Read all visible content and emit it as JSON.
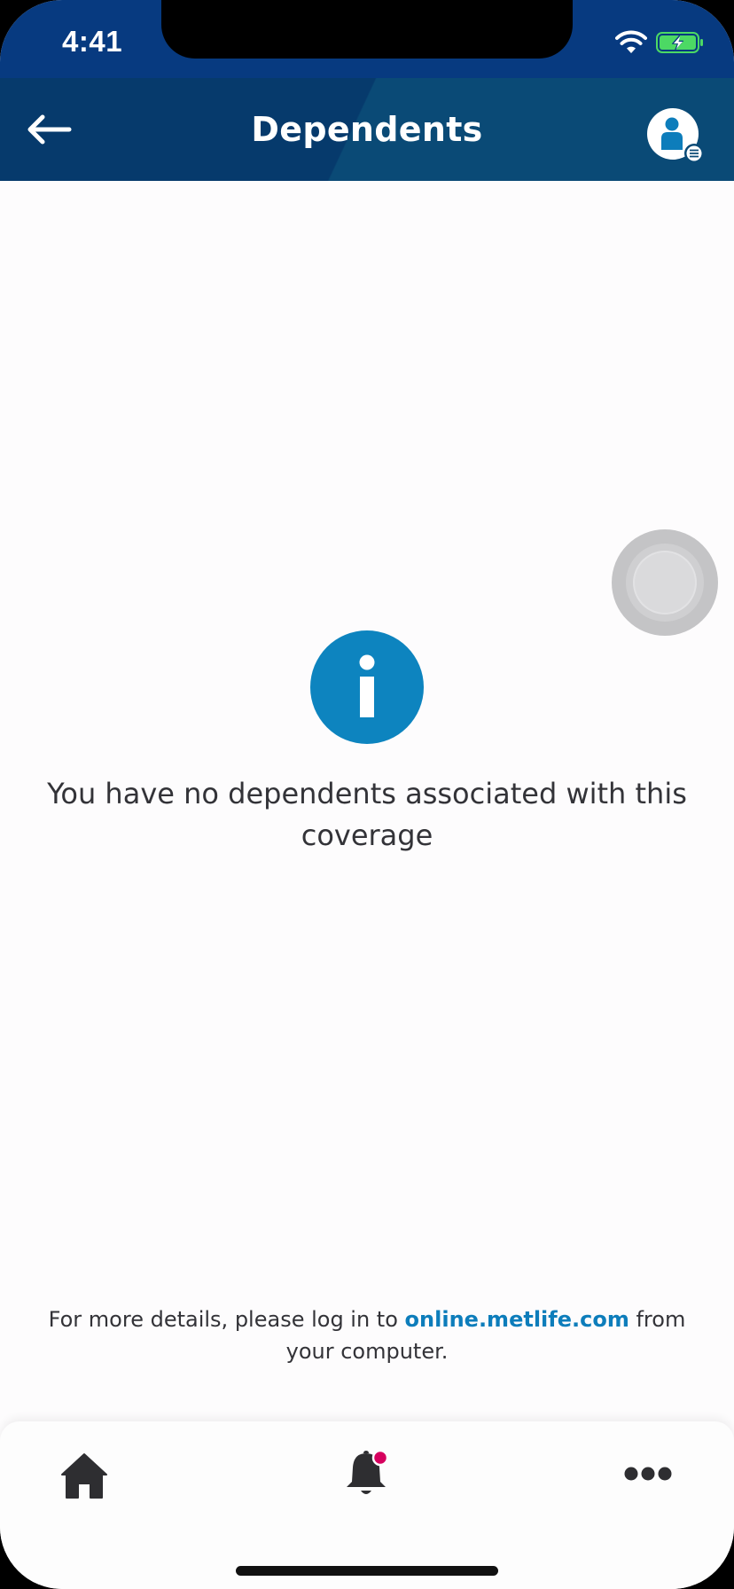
{
  "status_bar": {
    "time": "4:41",
    "icons": [
      "wifi-icon",
      "battery-charging-icon"
    ]
  },
  "header": {
    "title": "Dependents",
    "back_icon": "arrow-left-icon",
    "profile_icon": "user-menu-icon"
  },
  "empty_state": {
    "icon": "info-icon",
    "message": "You have no dependents associated with this coverage"
  },
  "footer_note": {
    "text_before": "For more details, please log in to",
    "link_text": "online.metlife.com",
    "text_after": "from your computer."
  },
  "tab_bar": {
    "items": [
      {
        "name": "home",
        "icon": "home-icon"
      },
      {
        "name": "notifications",
        "icon": "bell-icon",
        "has_badge": true
      },
      {
        "name": "more",
        "icon": "more-dots-icon"
      }
    ]
  },
  "colors": {
    "status_bar": "#073a80",
    "header": "#063a6c",
    "accent": "#0d7dbb",
    "badge": "#d6005e",
    "text": "#333338",
    "battery": "#4cd964"
  }
}
